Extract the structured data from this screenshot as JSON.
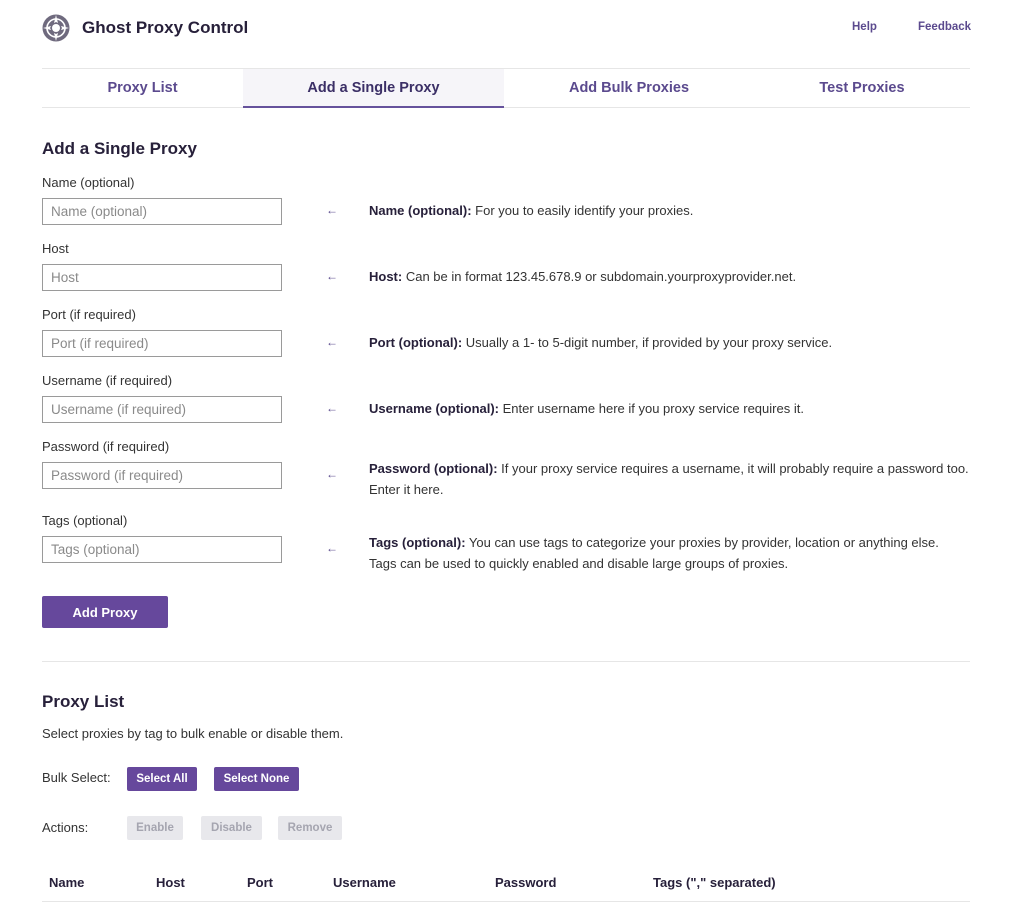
{
  "header": {
    "app_title": "Ghost Proxy Control",
    "logo_icon": "compass-logo-icon",
    "links": {
      "help": "Help",
      "feedback": "Feedback"
    }
  },
  "tabs": [
    {
      "label": "Proxy List",
      "active": false
    },
    {
      "label": "Add a Single Proxy",
      "active": true
    },
    {
      "label": "Add Bulk Proxies",
      "active": false
    },
    {
      "label": "Test Proxies",
      "active": false
    }
  ],
  "add_form": {
    "title": "Add a Single Proxy",
    "fields": [
      {
        "label": "Name (optional)",
        "placeholder": "Name (optional)",
        "value": "",
        "help_bold": "Name (optional):",
        "help_text": " For you to easily identify your proxies."
      },
      {
        "label": "Host",
        "placeholder": "Host",
        "value": "",
        "help_bold": "Host:",
        "help_text": " Can be in format 123.45.678.9 or subdomain.yourproxyprovider.net."
      },
      {
        "label": "Port (if required)",
        "placeholder": "Port (if required)",
        "value": "",
        "help_bold": "Port (optional):",
        "help_text": " Usually a 1- to 5-digit number, if provided by your proxy service."
      },
      {
        "label": "Username (if required)",
        "placeholder": "Username (if required)",
        "value": "",
        "help_bold": "Username (optional):",
        "help_text": " Enter username here if you proxy service requires it."
      },
      {
        "label": "Password (if required)",
        "placeholder": "Password (if required)",
        "value": "",
        "help_bold": "Password (optional):",
        "help_text": " If your proxy service requires a username, it will probably require a password too. Enter it here."
      },
      {
        "label": "Tags (optional)",
        "placeholder": "Tags (optional)",
        "value": "",
        "help_bold": "Tags (optional):",
        "help_text": " You can use tags to categorize your proxies by provider, location or anything else. Tags can be used to quickly enabled and disable large groups of proxies."
      }
    ],
    "arrow_glyph": "←",
    "submit_label": "Add Proxy"
  },
  "proxy_list": {
    "title": "Proxy List",
    "description": "Select proxies by tag to bulk enable or disable them.",
    "bulk_select_label": "Bulk Select:",
    "select_all_label": "Select All",
    "select_none_label": "Select None",
    "actions_label": "Actions:",
    "enable_label": "Enable",
    "disable_label": "Disable",
    "remove_label": "Remove",
    "columns": [
      "Name",
      "Host",
      "Port",
      "Username",
      "Password",
      "Tags (\",\" separated)"
    ]
  },
  "colors": {
    "accent": "#66489c",
    "link": "#5b4a8e",
    "heading": "#27203a"
  }
}
